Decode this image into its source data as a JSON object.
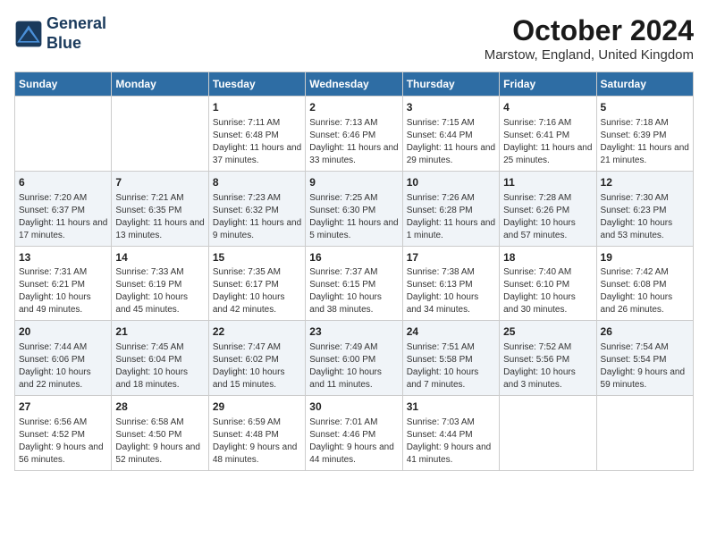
{
  "header": {
    "logo_line1": "General",
    "logo_line2": "Blue",
    "month_title": "October 2024",
    "location": "Marstow, England, United Kingdom"
  },
  "weekdays": [
    "Sunday",
    "Monday",
    "Tuesday",
    "Wednesday",
    "Thursday",
    "Friday",
    "Saturday"
  ],
  "weeks": [
    [
      {
        "day": "",
        "info": ""
      },
      {
        "day": "",
        "info": ""
      },
      {
        "day": "1",
        "info": "Sunrise: 7:11 AM\nSunset: 6:48 PM\nDaylight: 11 hours and 37 minutes."
      },
      {
        "day": "2",
        "info": "Sunrise: 7:13 AM\nSunset: 6:46 PM\nDaylight: 11 hours and 33 minutes."
      },
      {
        "day": "3",
        "info": "Sunrise: 7:15 AM\nSunset: 6:44 PM\nDaylight: 11 hours and 29 minutes."
      },
      {
        "day": "4",
        "info": "Sunrise: 7:16 AM\nSunset: 6:41 PM\nDaylight: 11 hours and 25 minutes."
      },
      {
        "day": "5",
        "info": "Sunrise: 7:18 AM\nSunset: 6:39 PM\nDaylight: 11 hours and 21 minutes."
      }
    ],
    [
      {
        "day": "6",
        "info": "Sunrise: 7:20 AM\nSunset: 6:37 PM\nDaylight: 11 hours and 17 minutes."
      },
      {
        "day": "7",
        "info": "Sunrise: 7:21 AM\nSunset: 6:35 PM\nDaylight: 11 hours and 13 minutes."
      },
      {
        "day": "8",
        "info": "Sunrise: 7:23 AM\nSunset: 6:32 PM\nDaylight: 11 hours and 9 minutes."
      },
      {
        "day": "9",
        "info": "Sunrise: 7:25 AM\nSunset: 6:30 PM\nDaylight: 11 hours and 5 minutes."
      },
      {
        "day": "10",
        "info": "Sunrise: 7:26 AM\nSunset: 6:28 PM\nDaylight: 11 hours and 1 minute."
      },
      {
        "day": "11",
        "info": "Sunrise: 7:28 AM\nSunset: 6:26 PM\nDaylight: 10 hours and 57 minutes."
      },
      {
        "day": "12",
        "info": "Sunrise: 7:30 AM\nSunset: 6:23 PM\nDaylight: 10 hours and 53 minutes."
      }
    ],
    [
      {
        "day": "13",
        "info": "Sunrise: 7:31 AM\nSunset: 6:21 PM\nDaylight: 10 hours and 49 minutes."
      },
      {
        "day": "14",
        "info": "Sunrise: 7:33 AM\nSunset: 6:19 PM\nDaylight: 10 hours and 45 minutes."
      },
      {
        "day": "15",
        "info": "Sunrise: 7:35 AM\nSunset: 6:17 PM\nDaylight: 10 hours and 42 minutes."
      },
      {
        "day": "16",
        "info": "Sunrise: 7:37 AM\nSunset: 6:15 PM\nDaylight: 10 hours and 38 minutes."
      },
      {
        "day": "17",
        "info": "Sunrise: 7:38 AM\nSunset: 6:13 PM\nDaylight: 10 hours and 34 minutes."
      },
      {
        "day": "18",
        "info": "Sunrise: 7:40 AM\nSunset: 6:10 PM\nDaylight: 10 hours and 30 minutes."
      },
      {
        "day": "19",
        "info": "Sunrise: 7:42 AM\nSunset: 6:08 PM\nDaylight: 10 hours and 26 minutes."
      }
    ],
    [
      {
        "day": "20",
        "info": "Sunrise: 7:44 AM\nSunset: 6:06 PM\nDaylight: 10 hours and 22 minutes."
      },
      {
        "day": "21",
        "info": "Sunrise: 7:45 AM\nSunset: 6:04 PM\nDaylight: 10 hours and 18 minutes."
      },
      {
        "day": "22",
        "info": "Sunrise: 7:47 AM\nSunset: 6:02 PM\nDaylight: 10 hours and 15 minutes."
      },
      {
        "day": "23",
        "info": "Sunrise: 7:49 AM\nSunset: 6:00 PM\nDaylight: 10 hours and 11 minutes."
      },
      {
        "day": "24",
        "info": "Sunrise: 7:51 AM\nSunset: 5:58 PM\nDaylight: 10 hours and 7 minutes."
      },
      {
        "day": "25",
        "info": "Sunrise: 7:52 AM\nSunset: 5:56 PM\nDaylight: 10 hours and 3 minutes."
      },
      {
        "day": "26",
        "info": "Sunrise: 7:54 AM\nSunset: 5:54 PM\nDaylight: 9 hours and 59 minutes."
      }
    ],
    [
      {
        "day": "27",
        "info": "Sunrise: 6:56 AM\nSunset: 4:52 PM\nDaylight: 9 hours and 56 minutes."
      },
      {
        "day": "28",
        "info": "Sunrise: 6:58 AM\nSunset: 4:50 PM\nDaylight: 9 hours and 52 minutes."
      },
      {
        "day": "29",
        "info": "Sunrise: 6:59 AM\nSunset: 4:48 PM\nDaylight: 9 hours and 48 minutes."
      },
      {
        "day": "30",
        "info": "Sunrise: 7:01 AM\nSunset: 4:46 PM\nDaylight: 9 hours and 44 minutes."
      },
      {
        "day": "31",
        "info": "Sunrise: 7:03 AM\nSunset: 4:44 PM\nDaylight: 9 hours and 41 minutes."
      },
      {
        "day": "",
        "info": ""
      },
      {
        "day": "",
        "info": ""
      }
    ]
  ]
}
